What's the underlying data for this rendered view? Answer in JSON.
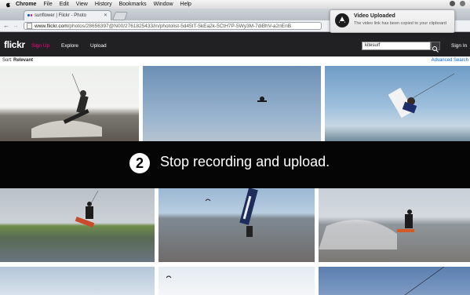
{
  "menubar": {
    "app": "Chrome",
    "items": [
      "File",
      "Edit",
      "View",
      "History",
      "Bookmarks",
      "Window",
      "Help"
    ]
  },
  "tab": {
    "title": "sunflower | Flickr - Photo"
  },
  "address": {
    "host": "www.flickr.com",
    "path": "/photos/28656397@N00/2761825433/in/photolist-5d45tT-5kEa2k-5CtH7P-5Wy3M-7diBhV-a2nEnB"
  },
  "notification": {
    "title": "Video Uploaded",
    "body": "The video link has been copied to your clipboard"
  },
  "flickr": {
    "logo": "flickr",
    "nav": [
      "Sign Up",
      "Explore",
      "Upload"
    ],
    "search_value": "kitesurf",
    "sign_in": "Sign In",
    "sort_label": "Sort:",
    "sort_value": "Relevant",
    "advanced_search": "Advanced Search"
  },
  "banner": {
    "step": "2",
    "text": "Stop recording and upload."
  },
  "colors": {
    "flickr_pink": "#ff0084",
    "flickr_blue": "#0063dc",
    "header_bg": "#212124"
  }
}
